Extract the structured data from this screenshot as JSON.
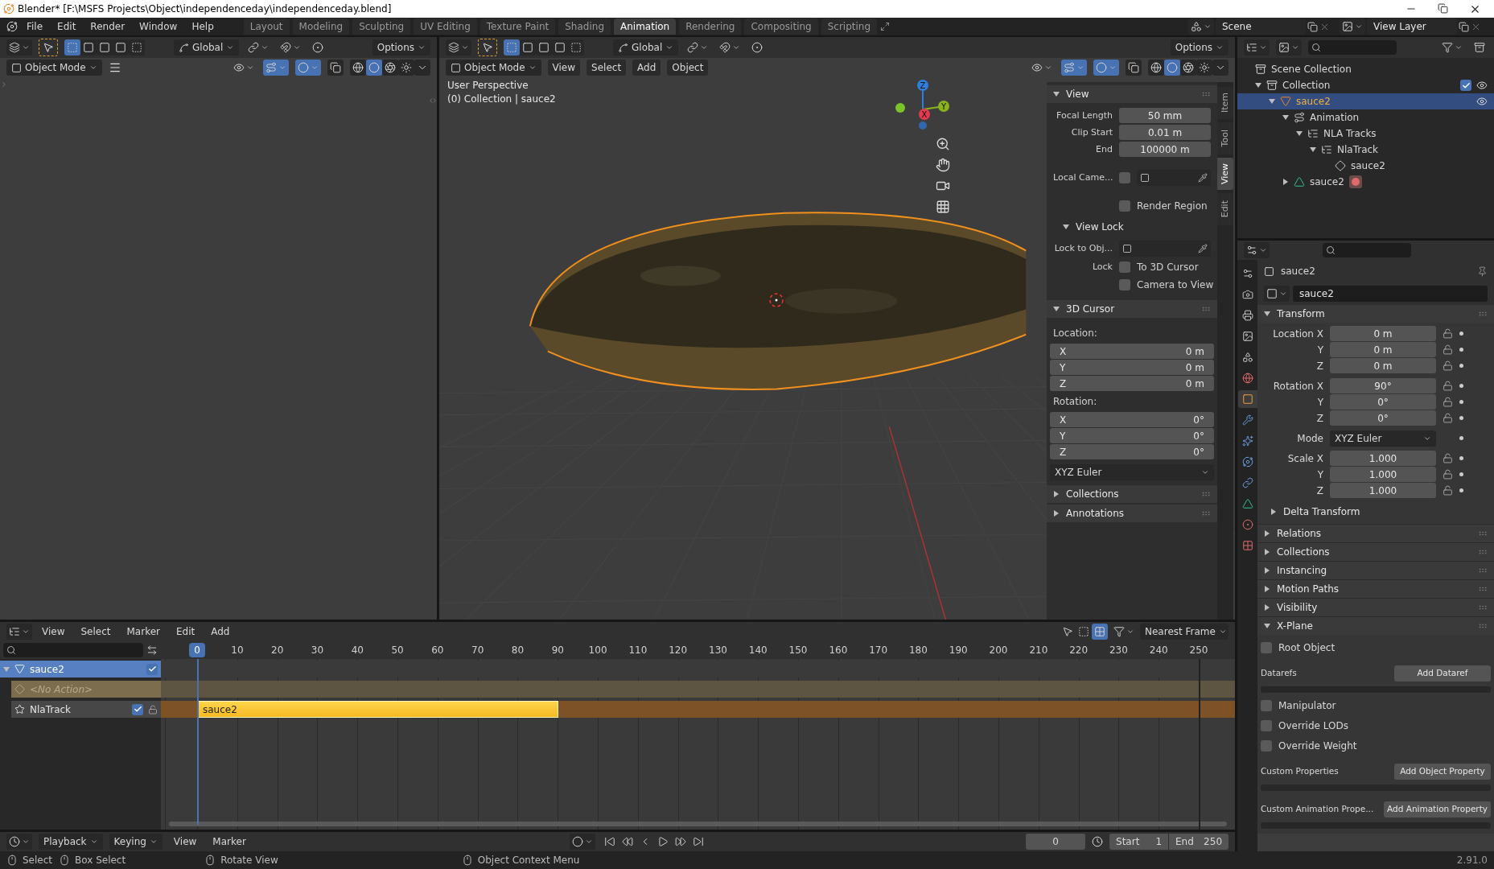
{
  "window": {
    "title": "Blender* [F:\\MSFS Projects\\Object\\independenceday\\independenceday.blend]"
  },
  "menu": [
    "File",
    "Edit",
    "Render",
    "Window",
    "Help"
  ],
  "workspaces": [
    {
      "label": "Layout",
      "selected": false
    },
    {
      "label": "Modeling",
      "selected": false
    },
    {
      "label": "Sculpting",
      "selected": false
    },
    {
      "label": "UV Editing",
      "selected": false
    },
    {
      "label": "Texture Paint",
      "selected": false
    },
    {
      "label": "Shading",
      "selected": false
    },
    {
      "label": "Animation",
      "selected": true
    },
    {
      "label": "Rendering",
      "selected": false
    },
    {
      "label": "Compositing",
      "selected": false
    },
    {
      "label": "Scripting",
      "selected": false
    }
  ],
  "scene": "Scene",
  "view_layer": "View Layer",
  "left_view": {
    "orientation": "Global",
    "options": "Options",
    "mode": "Object Mode"
  },
  "viewport": {
    "orientation": "Global",
    "options": "Options",
    "mode": "Object Mode",
    "menus": [
      "View",
      "Select",
      "Add",
      "Object"
    ],
    "info": [
      "User Perspective",
      "(0) Collection | sauce2"
    ],
    "gizmo_axes": [
      "Z",
      "Y",
      "X"
    ]
  },
  "sidebar": {
    "tabs": [
      {
        "label": "Item",
        "selected": false
      },
      {
        "label": "Tool",
        "selected": false
      },
      {
        "label": "View",
        "selected": true
      },
      {
        "label": "Edit",
        "selected": false
      }
    ],
    "view": {
      "title": "View",
      "expanded": true,
      "fields": [
        {
          "label": "Focal Length",
          "value": "50 mm"
        },
        {
          "label": "Clip Start",
          "value": "0.01 m"
        },
        {
          "label": "End",
          "value": "100000 m"
        }
      ],
      "local_camera": {
        "label": "Local Came...",
        "checked": false
      },
      "render_region": {
        "label": "Render Region",
        "checked": false
      }
    },
    "view_lock": {
      "title": "View Lock",
      "expanded": true,
      "lock_object": "Lock to Obj...",
      "lock_label": "Lock",
      "options": [
        {
          "label": "To 3D Cursor",
          "checked": false
        },
        {
          "label": "Camera to View",
          "checked": false
        }
      ]
    },
    "cursor": {
      "title": "3D Cursor",
      "expanded": true,
      "location_label": "Location:",
      "location": [
        {
          "axis": "X",
          "value": "0 m"
        },
        {
          "axis": "Y",
          "value": "0 m"
        },
        {
          "axis": "Z",
          "value": "0 m"
        }
      ],
      "rotation_label": "Rotation:",
      "rotation": [
        {
          "axis": "X",
          "value": "0°"
        },
        {
          "axis": "Y",
          "value": "0°"
        },
        {
          "axis": "Z",
          "value": "0°"
        }
      ],
      "rotation_mode": "XYZ Euler"
    },
    "closed_panels": [
      {
        "title": "Collections",
        "expanded": false
      },
      {
        "title": "Annotations",
        "expanded": false
      }
    ]
  },
  "outliner": {
    "root": "Scene Collection",
    "tree": [
      {
        "label": "Collection",
        "kind": "collection",
        "expanded": true,
        "checked": true,
        "selected": false,
        "children": [
          {
            "label": "sauce2",
            "kind": "object",
            "expanded": true,
            "selected": true,
            "children": [
              {
                "label": "Animation",
                "kind": "animation",
                "expanded": true,
                "selected": false,
                "children": [
                  {
                    "label": "NLA Tracks",
                    "kind": "nla",
                    "expanded": true,
                    "selected": false,
                    "children": [
                      {
                        "label": "NlaTrack",
                        "kind": "nla",
                        "expanded": true,
                        "selected": false,
                        "children": [
                          {
                            "label": "sauce2",
                            "kind": "strip",
                            "selected": false
                          }
                        ]
                      }
                    ]
                  }
                ]
              },
              {
                "label": "sauce2",
                "kind": "mesh",
                "expanded": false,
                "selected": false
              }
            ]
          }
        ]
      }
    ]
  },
  "properties": {
    "tabs": [
      {
        "kind": "tool",
        "selected": false
      },
      {
        "kind": "render",
        "selected": false
      },
      {
        "kind": "output",
        "selected": false
      },
      {
        "kind": "view_layer",
        "selected": false
      },
      {
        "kind": "scene",
        "selected": false
      },
      {
        "kind": "world",
        "selected": false
      },
      {
        "kind": "object",
        "selected": true
      },
      {
        "kind": "modifiers",
        "selected": false
      },
      {
        "kind": "particles",
        "selected": false
      },
      {
        "kind": "physics",
        "selected": false
      },
      {
        "kind": "constraints",
        "selected": false
      },
      {
        "kind": "data",
        "selected": false
      },
      {
        "kind": "material",
        "selected": false
      },
      {
        "kind": "texture",
        "selected": false
      }
    ],
    "context": "sauce2",
    "object_name": "sauce2",
    "transform": {
      "title": "Transform",
      "expanded": true,
      "groups": [
        [
          {
            "label": "Location X",
            "value": "0 m",
            "kind": "number"
          },
          {
            "label": "Y",
            "value": "0 m",
            "kind": "number"
          },
          {
            "label": "Z",
            "value": "0 m",
            "kind": "number"
          }
        ],
        [
          {
            "label": "Rotation X",
            "value": "90°",
            "kind": "number"
          },
          {
            "label": "Y",
            "value": "0°",
            "kind": "number"
          },
          {
            "label": "Z",
            "value": "0°",
            "kind": "number"
          }
        ],
        [
          {
            "label": "Mode",
            "value": "XYZ Euler",
            "kind": "dropdown"
          }
        ],
        [
          {
            "label": "Scale X",
            "value": "1.000",
            "kind": "number"
          },
          {
            "label": "Y",
            "value": "1.000",
            "kind": "number"
          },
          {
            "label": "Z",
            "value": "1.000",
            "kind": "number"
          }
        ]
      ],
      "subpanel": {
        "title": "Delta Transform",
        "expanded": false
      }
    },
    "panels": [
      {
        "title": "Relations",
        "expanded": false
      },
      {
        "title": "Collections",
        "expanded": false
      },
      {
        "title": "Instancing",
        "expanded": false
      },
      {
        "title": "Motion Paths",
        "expanded": false
      },
      {
        "title": "Visibility",
        "expanded": false
      },
      {
        "title": "X-Plane",
        "expanded": true
      }
    ],
    "xplane": [
      {
        "kind": "checkbox",
        "label": "Root Object",
        "checked": false
      },
      {
        "kind": "button_row",
        "label": "Datarefs",
        "button": "Add Dataref"
      },
      {
        "kind": "list"
      },
      {
        "kind": "checkbox",
        "label": "Manipulator",
        "checked": false
      },
      {
        "kind": "checkbox",
        "label": "Override LODs",
        "checked": false
      },
      {
        "kind": "checkbox",
        "label": "Override Weight",
        "checked": false
      },
      {
        "kind": "button_row",
        "label": "Custom Properties",
        "button": "Add Object Property"
      },
      {
        "kind": "list"
      },
      {
        "kind": "button_row",
        "label": "Custom Animation Prope...",
        "button": "Add Animation Property"
      },
      {
        "kind": "list"
      }
    ]
  },
  "nla": {
    "menus": [
      "View",
      "Select",
      "Marker",
      "Edit",
      "Add"
    ],
    "snap": "Nearest Frame",
    "current_frame": "0",
    "frames": [
      "10",
      "20",
      "30",
      "40",
      "50",
      "60",
      "70",
      "80",
      "90",
      "100",
      "110",
      "120",
      "130",
      "140",
      "150",
      "160",
      "170",
      "180",
      "190",
      "200",
      "210",
      "220",
      "230",
      "240",
      "250"
    ],
    "channels": [
      {
        "kind": "object",
        "label": "sauce2",
        "checked": true
      },
      {
        "kind": "action",
        "label": "<No Action>"
      },
      {
        "kind": "track",
        "label": "NlaTrack",
        "checked": true
      }
    ],
    "strip": "sauce2"
  },
  "timeline": {
    "menus": [
      "Playback",
      "Keying",
      "View",
      "Marker"
    ],
    "frame": "0",
    "start": {
      "label": "Start",
      "value": "1"
    },
    "end": {
      "label": "End",
      "value": "250"
    }
  },
  "status": {
    "items": [
      {
        "kind": "left",
        "label": "Select"
      },
      {
        "kind": "left",
        "label": "Box Select"
      },
      {
        "kind": "middle",
        "label": "Rotate View"
      },
      {
        "kind": "right",
        "label": "Object Context Menu"
      }
    ],
    "version": "2.91.0"
  }
}
